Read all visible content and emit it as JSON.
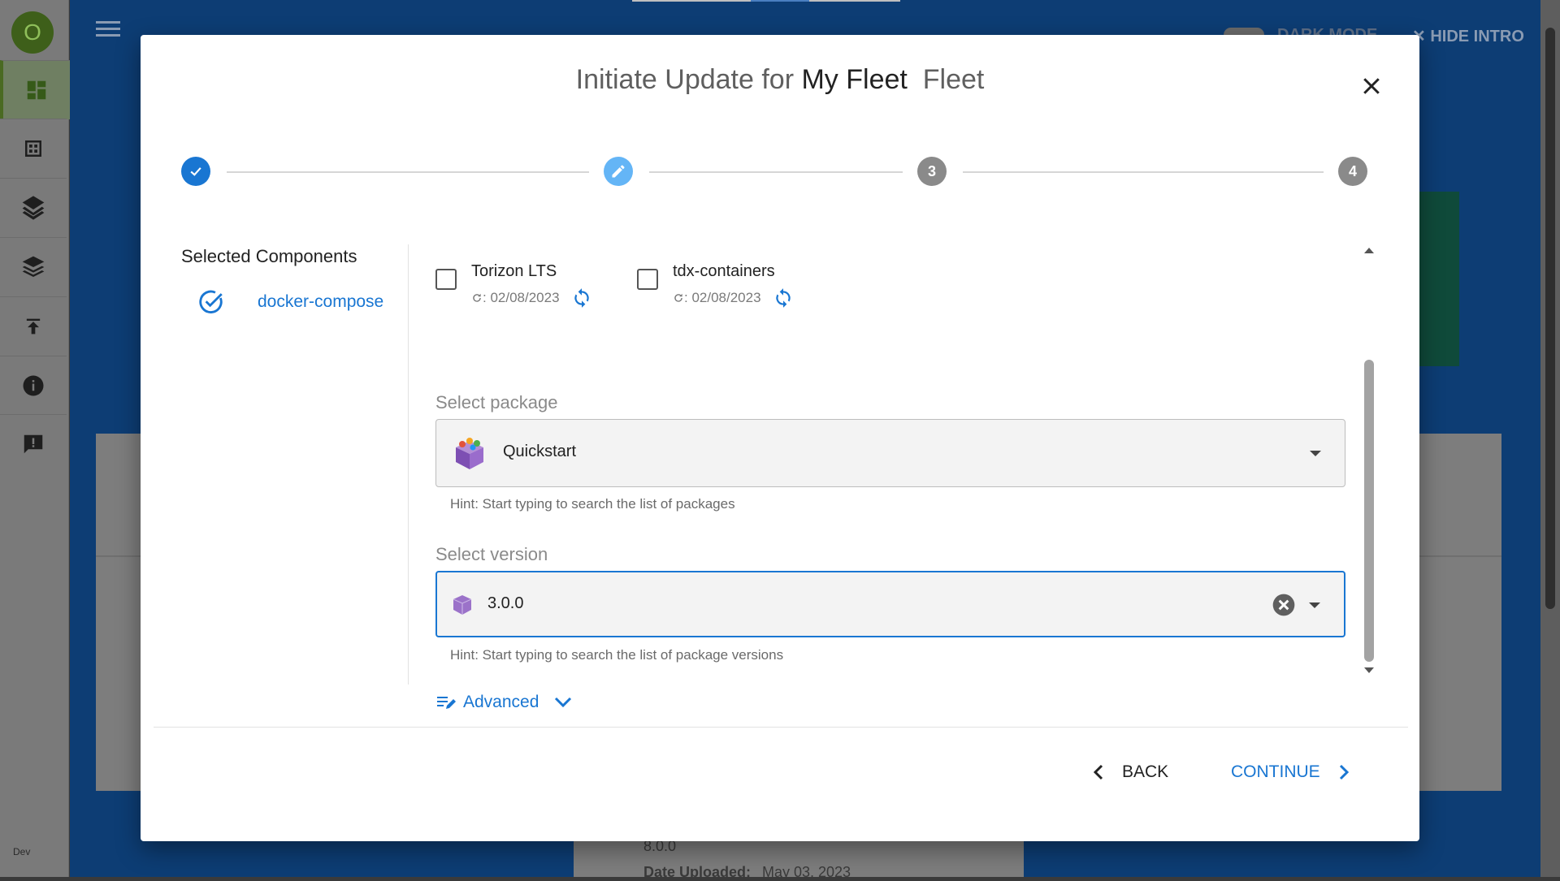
{
  "sidebar": {
    "avatar_letter": "O",
    "env_label": "Dev",
    "icons": [
      "dashboard-icon",
      "devices-icon",
      "layers-icon",
      "packages-icon",
      "upload-icon",
      "info-icon",
      "feedback-icon"
    ]
  },
  "background": {
    "dark_mode_label": "DARK MODE",
    "hide_intro_label": "HIDE INTRO",
    "bottom_version": "8.0.0",
    "bottom_date_label": "Date Uploaded:",
    "bottom_date_value": "May 03, 2023"
  },
  "modal": {
    "title_prefix": "Initiate Update for",
    "title_fleet_name": "My Fleet",
    "title_suffix": "Fleet",
    "stepper": {
      "steps": [
        {
          "state": "complete"
        },
        {
          "state": "editing"
        },
        {
          "state": "pending",
          "number": "3"
        },
        {
          "state": "pending",
          "number": "4"
        }
      ]
    },
    "selected_components": {
      "title": "Selected Components",
      "items": [
        {
          "label": "docker-compose",
          "checked": true
        }
      ]
    },
    "components": [
      {
        "name": "Torizon LTS",
        "date": ": 02/08/2023",
        "checked": false
      },
      {
        "name": "tdx-containers",
        "date": ": 02/08/2023",
        "checked": false
      }
    ],
    "package": {
      "label": "Select package",
      "value": "Quickstart",
      "hint": "Hint: Start typing to search the list of packages"
    },
    "version": {
      "label": "Select version",
      "value": "3.0.0",
      "hint": "Hint: Start typing to search the list of package versions"
    },
    "advanced_label": "Advanced",
    "back_label": "BACK",
    "continue_label": "CONTINUE"
  },
  "colors": {
    "primary": "#1976d2",
    "step_active": "#64b5f6",
    "step_pending": "#8a8a8a"
  }
}
